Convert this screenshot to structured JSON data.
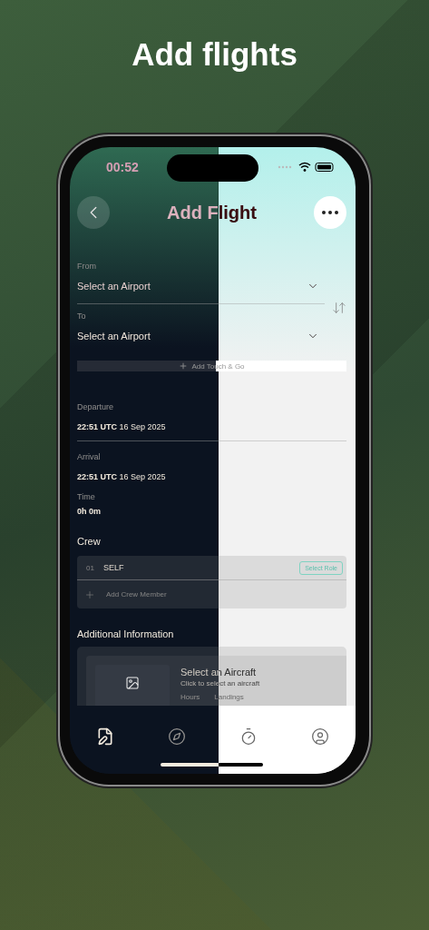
{
  "headline": "Add flights",
  "status_bar": {
    "time": "00:52"
  },
  "header": {
    "title": "Add Flight"
  },
  "route": [
    {
      "label": "From",
      "value": "Select an Airport"
    },
    {
      "label": "To",
      "value": "Select an Airport"
    }
  ],
  "touch_and_go": "Add Touch & Go",
  "times": [
    {
      "label": "Departure",
      "time": "22:51 UTC",
      "date": "16 Sep 2025"
    },
    {
      "label": "Arrival",
      "time": "22:51 UTC",
      "date": "16 Sep 2025"
    }
  ],
  "duration": {
    "label": "Time",
    "value": "0h 0m"
  },
  "crew": {
    "title": "Crew",
    "members": [
      {
        "number": "01",
        "name": "SELF",
        "role_button": "Select Role"
      }
    ],
    "add": "Add Crew Member"
  },
  "additional": {
    "title": "Additional Information",
    "aircraft": {
      "title": "Select an Aircraft",
      "subtitle": "Click to select an aircraft",
      "stats": [
        "Hours",
        "Landings"
      ]
    }
  },
  "tab_bar": [
    {
      "selected": true
    },
    {
      "selected": false
    },
    {
      "selected": false
    },
    {
      "selected": false
    }
  ]
}
